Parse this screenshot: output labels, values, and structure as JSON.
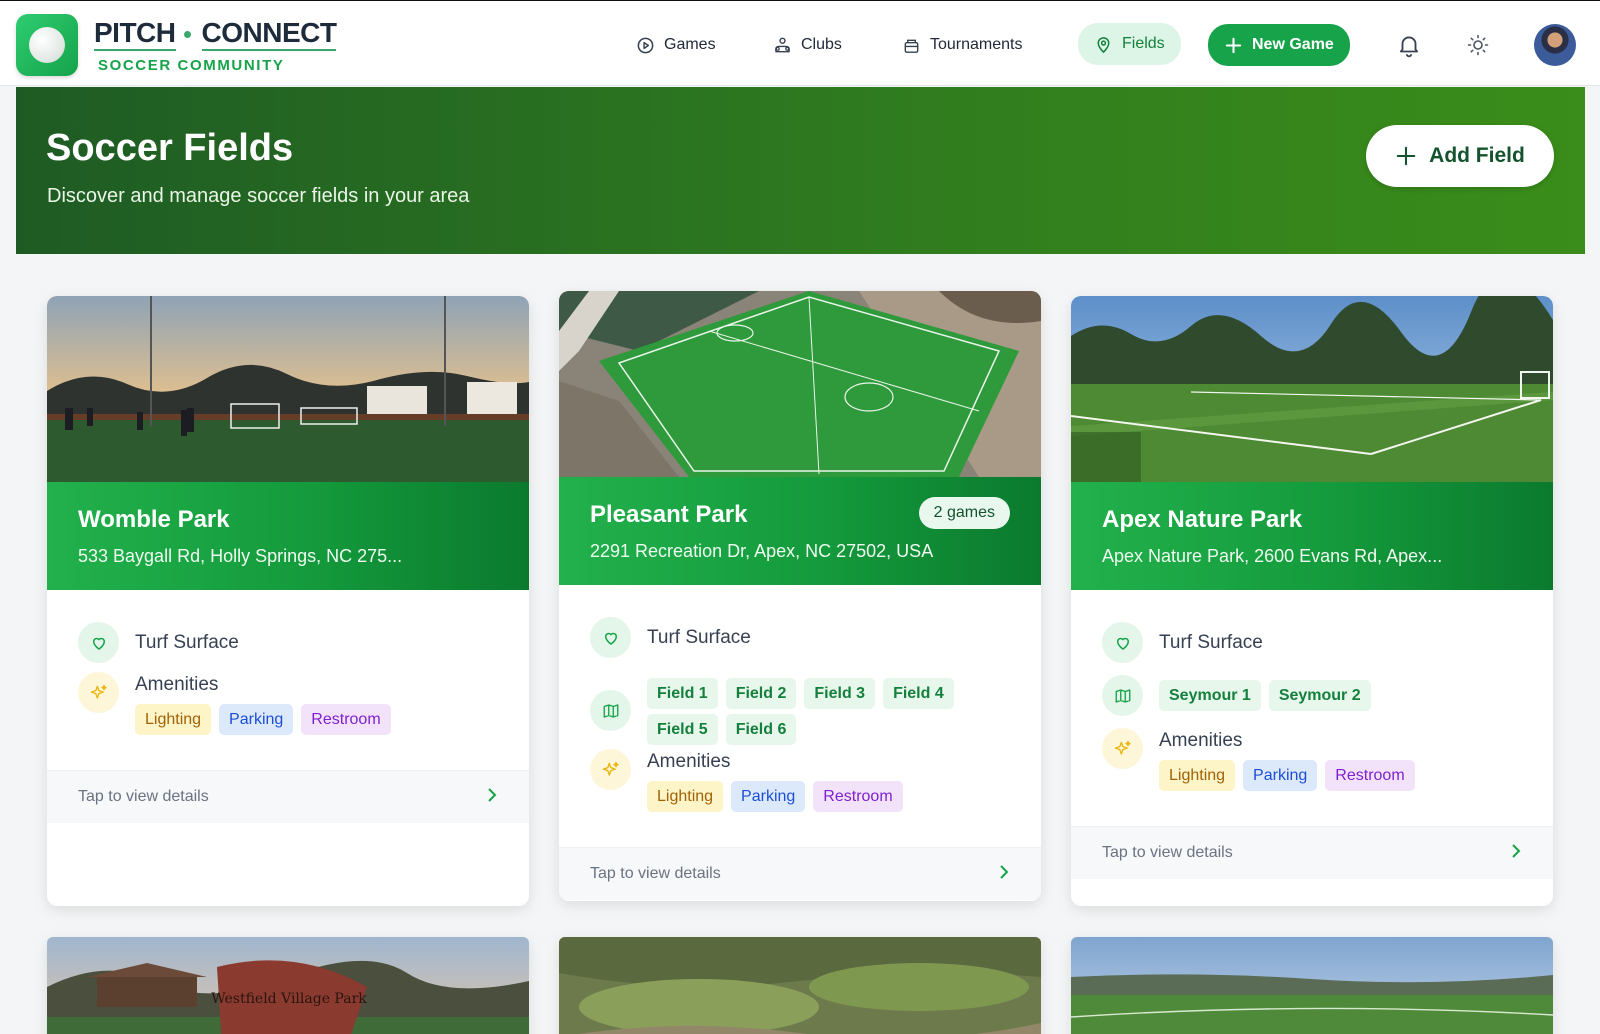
{
  "brand": {
    "name_left": "PITCH",
    "name_right": "CONNECT",
    "tagline": "SOCCER COMMUNITY"
  },
  "nav": {
    "items": [
      {
        "label": "Games",
        "icon": "play-circle-icon"
      },
      {
        "label": "Clubs",
        "icon": "clubs-icon"
      },
      {
        "label": "Tournaments",
        "icon": "tournament-icon"
      },
      {
        "label": "Fields",
        "icon": "map-pin-icon",
        "active": true
      }
    ],
    "new_game_label": "New Game"
  },
  "hero": {
    "title": "Soccer Fields",
    "subtitle": "Discover and manage soccer fields in your area",
    "add_field_label": "Add Field"
  },
  "cards": [
    {
      "name": "Womble Park",
      "address": "533 Baygall Rd, Holly Springs, NC 275...",
      "surface": "Turf Surface",
      "amenities_label": "Amenities",
      "amenities": [
        "Lighting",
        "Parking",
        "Restroom"
      ],
      "footer": "Tap to view details"
    },
    {
      "name": "Pleasant Park",
      "address": "2291 Recreation Dr, Apex, NC 27502, USA",
      "games_badge": "2 games",
      "surface": "Turf Surface",
      "fields": [
        "Field 1",
        "Field 2",
        "Field 3",
        "Field 4",
        "Field 5",
        "Field 6"
      ],
      "amenities_label": "Amenities",
      "amenities": [
        "Lighting",
        "Parking",
        "Restroom"
      ],
      "footer": "Tap to view details"
    },
    {
      "name": "Apex Nature Park",
      "address": "Apex Nature Park, 2600 Evans Rd, Apex...",
      "surface": "Turf Surface",
      "fields": [
        "Seymour 1",
        "Seymour 2"
      ],
      "amenities_label": "Amenities",
      "amenities": [
        "Lighting",
        "Parking",
        "Restroom"
      ],
      "footer": "Tap to view details"
    }
  ],
  "bottom_cards": [
    {
      "sign_text": "Westfield Village Park"
    },
    {},
    {}
  ],
  "colors": {
    "accent": "#16a34a",
    "hero_start": "#1e5b24",
    "hero_end": "#3a8d1a",
    "band_start": "#22b14c",
    "band_end": "#0b7a2e"
  }
}
